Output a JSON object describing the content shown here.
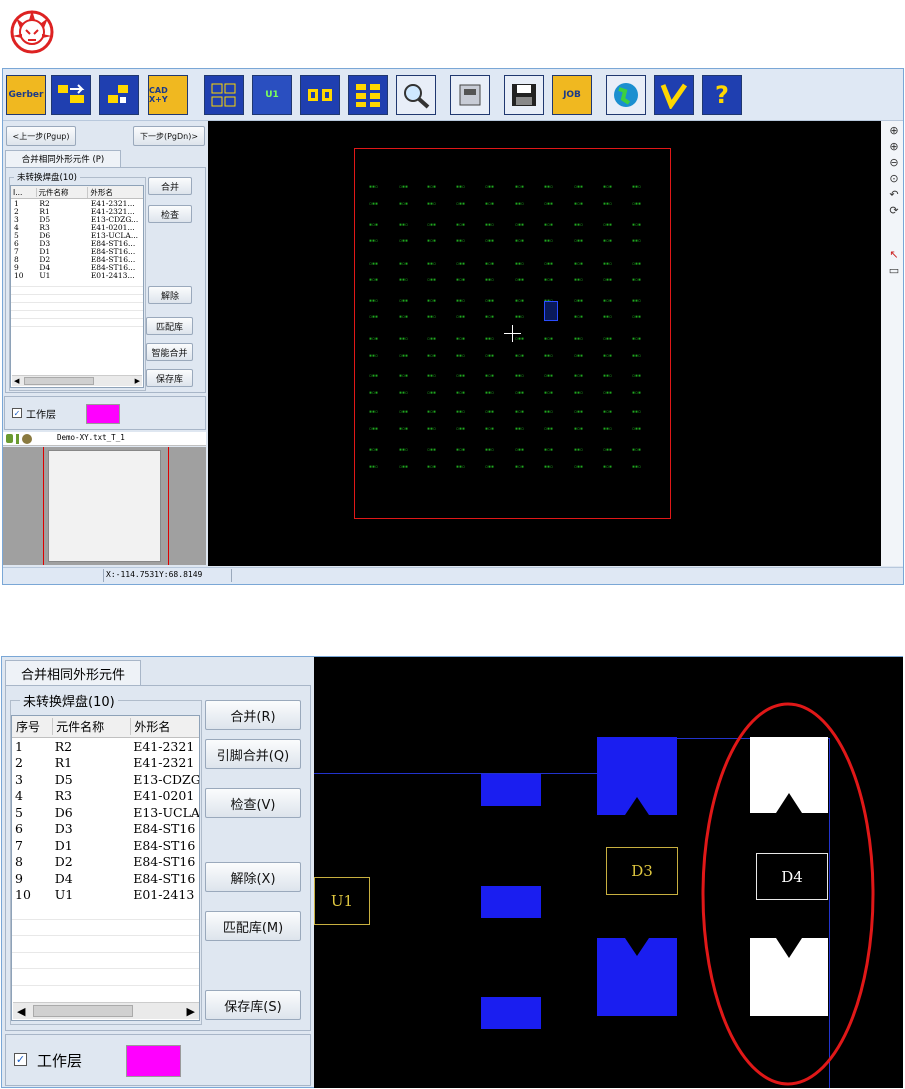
{
  "logo": "lion-logo",
  "toolbar": {
    "buttons": [
      "Gerber",
      "",
      "",
      "CAD X+Y",
      "",
      "U1",
      "",
      "",
      "",
      "",
      "",
      "JOB",
      "",
      "",
      "?"
    ]
  },
  "top": {
    "prev_button": "<上一步(Pgup)",
    "next_button": "下一步(PgDn)>",
    "tab": "合并相同外形元件 (P)",
    "group_title": "未转换焊盘(10)",
    "columns": [
      "I...",
      "元件名称",
      "外形名"
    ],
    "rows": [
      [
        "1",
        "R2",
        "E41-2321..."
      ],
      [
        "2",
        "R1",
        "E41-2321..."
      ],
      [
        "3",
        "D5",
        "E13-CDZG..."
      ],
      [
        "4",
        "R3",
        "E41-0201..."
      ],
      [
        "5",
        "D6",
        "E13-UCLA..."
      ],
      [
        "6",
        "D3",
        "E84-ST16..."
      ],
      [
        "7",
        "D1",
        "E84-ST16..."
      ],
      [
        "8",
        "D2",
        "E84-ST16..."
      ],
      [
        "9",
        "D4",
        "E84-ST16..."
      ],
      [
        "10",
        "U1",
        "E01-2413..."
      ]
    ],
    "buttons": {
      "merge": "合并",
      "check": "检查",
      "release": "解除",
      "match_lib": "匹配库",
      "smart_merge": "智能合并",
      "save_lib": "保存库"
    },
    "work_layer_label": "工作层",
    "work_layer_color": "#ff00ff",
    "layer_file": "Demo-XY.txt_T_1",
    "status_coords": "X:-114.7531Y:68.8149"
  },
  "zoom": {
    "tab": "合并相同外形元件",
    "group_title": "未转换焊盘(10)",
    "columns": [
      "序号",
      "元件名称",
      "外形名"
    ],
    "rows": [
      [
        "1",
        "R2",
        "E41-2321"
      ],
      [
        "2",
        "R1",
        "E41-2321"
      ],
      [
        "3",
        "D5",
        "E13-CDZG"
      ],
      [
        "4",
        "R3",
        "E41-0201"
      ],
      [
        "5",
        "D6",
        "E13-UCLA"
      ],
      [
        "6",
        "D3",
        "E84-ST16"
      ],
      [
        "7",
        "D1",
        "E84-ST16"
      ],
      [
        "8",
        "D2",
        "E84-ST16"
      ],
      [
        "9",
        "D4",
        "E84-ST16"
      ],
      [
        "10",
        "U1",
        "E01-2413"
      ]
    ],
    "buttons": {
      "merge": "合并(R)",
      "pin_merge": "引脚合并(Q)",
      "check": "检查(V)",
      "release": "解除(X)",
      "match_lib": "匹配库(M)",
      "save_lib": "保存库(S)"
    },
    "work_layer_label": "工作层",
    "work_layer_color": "#ff00ff",
    "canvas_labels": {
      "u1": "U1",
      "d3": "D3",
      "d4": "D4"
    }
  }
}
